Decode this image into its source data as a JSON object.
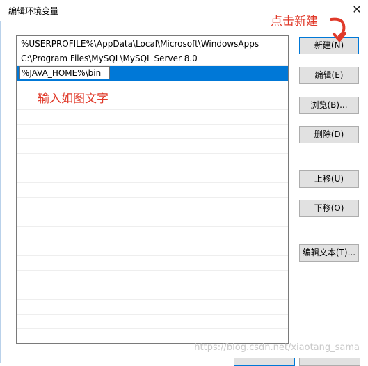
{
  "window": {
    "title": "编辑环境变量",
    "close_glyph": "✕"
  },
  "list": {
    "items": [
      "%USERPROFILE%\\AppData\\Local\\Microsoft\\WindowsApps",
      "C:\\Program Files\\MySQL\\MySQL Server 8.0"
    ],
    "editing_value": "%JAVA_HOME%\\bin"
  },
  "buttons": {
    "new": "新建(N)",
    "edit": "编辑(E)",
    "browse": "浏览(B)...",
    "delete": "删除(D)",
    "move_up": "上移(U)",
    "move_down": "下移(O)",
    "edit_text": "编辑文本(T)..."
  },
  "annotations": {
    "click_new": "点击新建",
    "input_hint": "输入如图文字"
  },
  "watermark": "https://blog.csdn.net/xiaotang_sama",
  "colors": {
    "selection": "#0078d7",
    "annotation": "#e03a2a"
  }
}
